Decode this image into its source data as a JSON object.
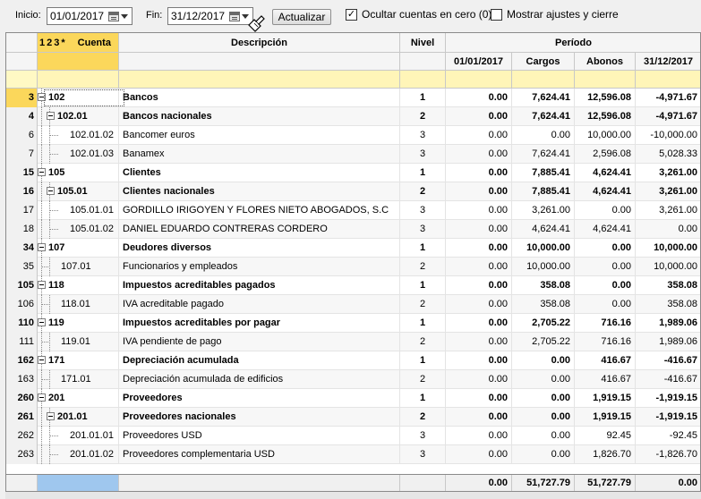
{
  "toolbar": {
    "inicio_label": "Inicio:",
    "inicio_value": "01/01/2017",
    "fin_label": "Fin:",
    "fin_value": "31/12/2017",
    "actualizar_label": "Actualizar",
    "ocultar_label": "Ocultar cuentas en cero (0)",
    "ocultar_checked": true,
    "mostrar_label": "Mostrar ajustes  y cierre",
    "mostrar_checked": false
  },
  "header": {
    "levels": [
      "1",
      "2",
      "3",
      "*"
    ],
    "cuenta": "Cuenta",
    "descripcion": "Descripción",
    "nivel": "Nivel",
    "periodo": "Período",
    "col_inicio": "01/01/2017",
    "col_cargos": "Cargos",
    "col_abonos": "Abonos",
    "col_fin": "31/12/2017"
  },
  "rows": [
    {
      "n": "3",
      "cuenta": "102",
      "desc": "Bancos",
      "nivel": "1",
      "ini": "0.00",
      "cargos": "7,624.41",
      "abonos": "12,596.08",
      "fin": "-4,971.67",
      "bold": true,
      "depth": 0,
      "box": true
    },
    {
      "n": "4",
      "cuenta": "102.01",
      "desc": "Bancos nacionales",
      "nivel": "2",
      "ini": "0.00",
      "cargos": "7,624.41",
      "abonos": "12,596.08",
      "fin": "-4,971.67",
      "bold": true,
      "depth": 1,
      "box": true
    },
    {
      "n": "6",
      "cuenta": "102.01.02",
      "desc": "Bancomer euros",
      "nivel": "3",
      "ini": "0.00",
      "cargos": "0.00",
      "abonos": "10,000.00",
      "fin": "-10,000.00",
      "bold": false,
      "depth": 2,
      "box": false
    },
    {
      "n": "7",
      "cuenta": "102.01.03",
      "desc": "Banamex",
      "nivel": "3",
      "ini": "0.00",
      "cargos": "7,624.41",
      "abonos": "2,596.08",
      "fin": "5,028.33",
      "bold": false,
      "depth": 2,
      "box": false
    },
    {
      "n": "15",
      "cuenta": "105",
      "desc": "Clientes",
      "nivel": "1",
      "ini": "0.00",
      "cargos": "7,885.41",
      "abonos": "4,624.41",
      "fin": "3,261.00",
      "bold": true,
      "depth": 0,
      "box": true
    },
    {
      "n": "16",
      "cuenta": "105.01",
      "desc": "Clientes nacionales",
      "nivel": "2",
      "ini": "0.00",
      "cargos": "7,885.41",
      "abonos": "4,624.41",
      "fin": "3,261.00",
      "bold": true,
      "depth": 1,
      "box": true
    },
    {
      "n": "17",
      "cuenta": "105.01.01",
      "desc": "GORDILLO IRIGOYEN Y FLORES NIETO ABOGADOS, S.C",
      "nivel": "3",
      "ini": "0.00",
      "cargos": "3,261.00",
      "abonos": "0.00",
      "fin": "3,261.00",
      "bold": false,
      "depth": 2,
      "box": false
    },
    {
      "n": "18",
      "cuenta": "105.01.02",
      "desc": "DANIEL EDUARDO CONTRERAS CORDERO",
      "nivel": "3",
      "ini": "0.00",
      "cargos": "4,624.41",
      "abonos": "4,624.41",
      "fin": "0.00",
      "bold": false,
      "depth": 2,
      "box": false
    },
    {
      "n": "34",
      "cuenta": "107",
      "desc": "Deudores diversos",
      "nivel": "1",
      "ini": "0.00",
      "cargos": "10,000.00",
      "abonos": "0.00",
      "fin": "10,000.00",
      "bold": true,
      "depth": 0,
      "box": true
    },
    {
      "n": "35",
      "cuenta": "107.01",
      "desc": "Funcionarios y empleados",
      "nivel": "2",
      "ini": "0.00",
      "cargos": "10,000.00",
      "abonos": "0.00",
      "fin": "10,000.00",
      "bold": false,
      "depth": 1,
      "box": false
    },
    {
      "n": "105",
      "cuenta": "118",
      "desc": "Impuestos acreditables pagados",
      "nivel": "1",
      "ini": "0.00",
      "cargos": "358.08",
      "abonos": "0.00",
      "fin": "358.08",
      "bold": true,
      "depth": 0,
      "box": true
    },
    {
      "n": "106",
      "cuenta": "118.01",
      "desc": "IVA acreditable pagado",
      "nivel": "2",
      "ini": "0.00",
      "cargos": "358.08",
      "abonos": "0.00",
      "fin": "358.08",
      "bold": false,
      "depth": 1,
      "box": false
    },
    {
      "n": "110",
      "cuenta": "119",
      "desc": "Impuestos acreditables por pagar",
      "nivel": "1",
      "ini": "0.00",
      "cargos": "2,705.22",
      "abonos": "716.16",
      "fin": "1,989.06",
      "bold": true,
      "depth": 0,
      "box": true
    },
    {
      "n": "111",
      "cuenta": "119.01",
      "desc": "IVA pendiente de pago",
      "nivel": "2",
      "ini": "0.00",
      "cargos": "2,705.22",
      "abonos": "716.16",
      "fin": "1,989.06",
      "bold": false,
      "depth": 1,
      "box": false
    },
    {
      "n": "162",
      "cuenta": "171",
      "desc": "Depreciación acumulada",
      "nivel": "1",
      "ini": "0.00",
      "cargos": "0.00",
      "abonos": "416.67",
      "fin": "-416.67",
      "bold": true,
      "depth": 0,
      "box": true
    },
    {
      "n": "163",
      "cuenta": "171.01",
      "desc": "Depreciación acumulada de edificios",
      "nivel": "2",
      "ini": "0.00",
      "cargos": "0.00",
      "abonos": "416.67",
      "fin": "-416.67",
      "bold": false,
      "depth": 1,
      "box": false
    },
    {
      "n": "260",
      "cuenta": "201",
      "desc": "Proveedores",
      "nivel": "1",
      "ini": "0.00",
      "cargos": "0.00",
      "abonos": "1,919.15",
      "fin": "-1,919.15",
      "bold": true,
      "depth": 0,
      "box": true
    },
    {
      "n": "261",
      "cuenta": "201.01",
      "desc": "Proveedores nacionales",
      "nivel": "2",
      "ini": "0.00",
      "cargos": "0.00",
      "abonos": "1,919.15",
      "fin": "-1,919.15",
      "bold": true,
      "depth": 1,
      "box": true
    },
    {
      "n": "262",
      "cuenta": "201.01.01",
      "desc": "Proveedores USD",
      "nivel": "3",
      "ini": "0.00",
      "cargos": "0.00",
      "abonos": "92.45",
      "fin": "-92.45",
      "bold": false,
      "depth": 2,
      "box": false
    },
    {
      "n": "263",
      "cuenta": "201.01.02",
      "desc": "Proveedores complementaria USD",
      "nivel": "3",
      "ini": "0.00",
      "cargos": "0.00",
      "abonos": "1,826.70",
      "fin": "-1,826.70",
      "bold": false,
      "depth": 2,
      "box": false
    }
  ],
  "totals": {
    "ini": "0.00",
    "cargos": "51,727.79",
    "abonos": "51,727.79",
    "fin": "0.00"
  }
}
